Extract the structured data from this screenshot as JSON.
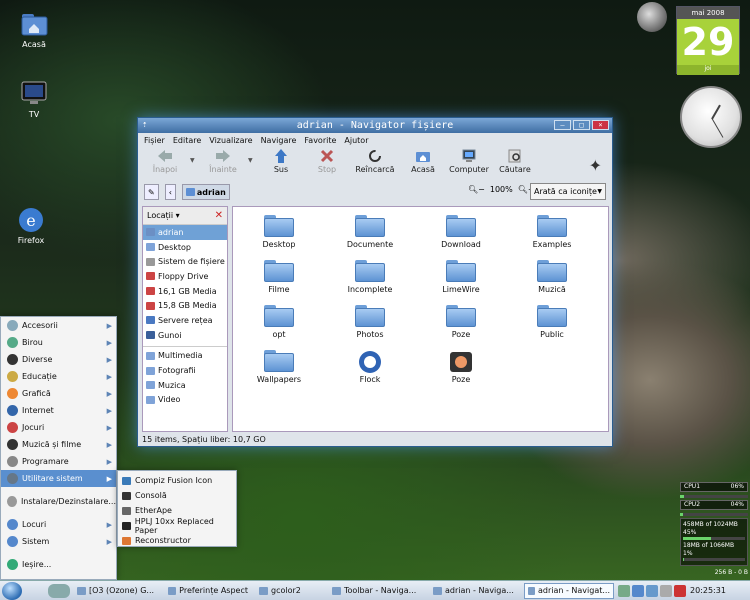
{
  "desktop": {
    "icons": [
      {
        "label": "Acasă",
        "icon": "home-folder-icon"
      },
      {
        "label": "TV",
        "icon": "tv-icon"
      },
      {
        "label": "Firefox",
        "icon": "firefox-icon"
      }
    ]
  },
  "calendar": {
    "month": "mai 2008",
    "day": "29",
    "weekday": "joi"
  },
  "window": {
    "title": "adrian - Navigator fișiere",
    "menu": [
      "Fișier",
      "Editare",
      "Vizualizare",
      "Navigare",
      "Favorite",
      "Ajutor"
    ],
    "toolbar": [
      {
        "label": "Înapoi",
        "icon": "back-arrow-icon",
        "disabled": true
      },
      {
        "label": "Înainte",
        "icon": "forward-arrow-icon",
        "disabled": true
      },
      {
        "label": "Sus",
        "icon": "up-arrow-icon",
        "disabled": false
      },
      {
        "label": "Stop",
        "icon": "stop-icon",
        "disabled": true
      },
      {
        "label": "Reîncarcă",
        "icon": "reload-icon",
        "disabled": false
      },
      {
        "label": "Acasă",
        "icon": "home-icon",
        "disabled": false
      },
      {
        "label": "Computer",
        "icon": "computer-icon",
        "disabled": false
      },
      {
        "label": "Căutare",
        "icon": "search-icon",
        "disabled": false
      }
    ],
    "location": {
      "path": "adrian",
      "zoom": "100%",
      "view": "Arată ca iconițe"
    },
    "sidebar": {
      "header": "Locații",
      "items": [
        {
          "label": "adrian",
          "color": "#6b8fc4",
          "selected": true
        },
        {
          "label": "Desktop",
          "color": "#7fa3d8",
          "selected": false
        },
        {
          "label": "Sistem de fișiere",
          "color": "#999999",
          "selected": false
        },
        {
          "label": "Floppy Drive",
          "color": "#cc4444",
          "selected": false
        },
        {
          "label": "16,1 GB Media",
          "color": "#cc4444",
          "selected": false
        },
        {
          "label": "15,8 GB Media",
          "color": "#cc4444",
          "selected": false
        },
        {
          "label": "Servere rețea",
          "color": "#4a79c2",
          "selected": false
        },
        {
          "label": "Gunoi",
          "color": "#3a5f9a",
          "selected": false
        }
      ],
      "bookmarks": [
        {
          "label": "Multimedia",
          "color": "#7fa3d8"
        },
        {
          "label": "Fotografii",
          "color": "#7fa3d8"
        },
        {
          "label": "Muzica",
          "color": "#7fa3d8"
        },
        {
          "label": "Video",
          "color": "#7fa3d8"
        }
      ]
    },
    "files": [
      {
        "label": "Desktop",
        "kind": "folder"
      },
      {
        "label": "Documente",
        "kind": "folder"
      },
      {
        "label": "Download",
        "kind": "folder"
      },
      {
        "label": "Examples",
        "kind": "folder"
      },
      {
        "label": "Filme",
        "kind": "folder"
      },
      {
        "label": "Incomplete",
        "kind": "folder"
      },
      {
        "label": "LimeWire",
        "kind": "folder"
      },
      {
        "label": "Muzică",
        "kind": "folder"
      },
      {
        "label": "opt",
        "kind": "folder"
      },
      {
        "label": "Photos",
        "kind": "folder"
      },
      {
        "label": "Poze",
        "kind": "folder"
      },
      {
        "label": "Public",
        "kind": "folder"
      },
      {
        "label": "Wallpapers",
        "kind": "folder"
      },
      {
        "label": "Flock",
        "kind": "app"
      },
      {
        "label": "Poze",
        "kind": "app"
      }
    ],
    "status": "15 items, Spațiu liber: 10,7 GO"
  },
  "startmenu": {
    "items": [
      {
        "label": "Accesorii",
        "color": "#8ab"
      },
      {
        "label": "Birou",
        "color": "#5a8"
      },
      {
        "label": "Diverse",
        "color": "#333"
      },
      {
        "label": "Educație",
        "color": "#ca4"
      },
      {
        "label": "Grafică",
        "color": "#e83"
      },
      {
        "label": "Internet",
        "color": "#36a"
      },
      {
        "label": "Jocuri",
        "color": "#c44"
      },
      {
        "label": "Muzică și filme",
        "color": "#333"
      },
      {
        "label": "Programare",
        "color": "#888"
      },
      {
        "label": "Utilitare sistem",
        "color": "#678"
      },
      {
        "label": "Instalare/Dezinstalare...",
        "color": "#999"
      },
      {
        "label": "Locuri",
        "color": "#58c"
      },
      {
        "label": "Sistem",
        "color": "#58c"
      },
      {
        "label": "Ieșire...",
        "color": "#3a7"
      }
    ],
    "submenu": [
      {
        "label": "Compiz Fusion Icon",
        "color": "#3a7ab8"
      },
      {
        "label": "Consolă",
        "color": "#333"
      },
      {
        "label": "EtherApe",
        "color": "#666"
      },
      {
        "label": "HPLJ 10xx Replaced Paper",
        "color": "#222"
      },
      {
        "label": "Reconstructor",
        "color": "#d73"
      }
    ]
  },
  "sysmon": {
    "cpu1_label": "CPU1",
    "cpu1_value": "06%",
    "cpu1_load": 0.06,
    "cpu2_label": "CPU2",
    "cpu2_value": "04%",
    "cpu2_load": 0.04,
    "mem1": "458MB of 1024MB  45%",
    "mem1_load": 0.45,
    "mem2": "18MB of 1066MB  1%",
    "mem2_load": 0.01,
    "net": "256 B - 0 B"
  },
  "taskbar": {
    "tasks": [
      {
        "label": "[O3 (Ozone) G...",
        "active": false
      },
      {
        "label": "Preferințe Aspect",
        "active": false
      },
      {
        "label": "gcolor2",
        "active": false
      },
      {
        "label": "Toolbar - Naviga...",
        "active": false
      },
      {
        "label": "adrian - Naviga...",
        "active": false
      },
      {
        "label": "adrian - Navigat...",
        "active": true
      }
    ],
    "clock": "20:25:31"
  }
}
